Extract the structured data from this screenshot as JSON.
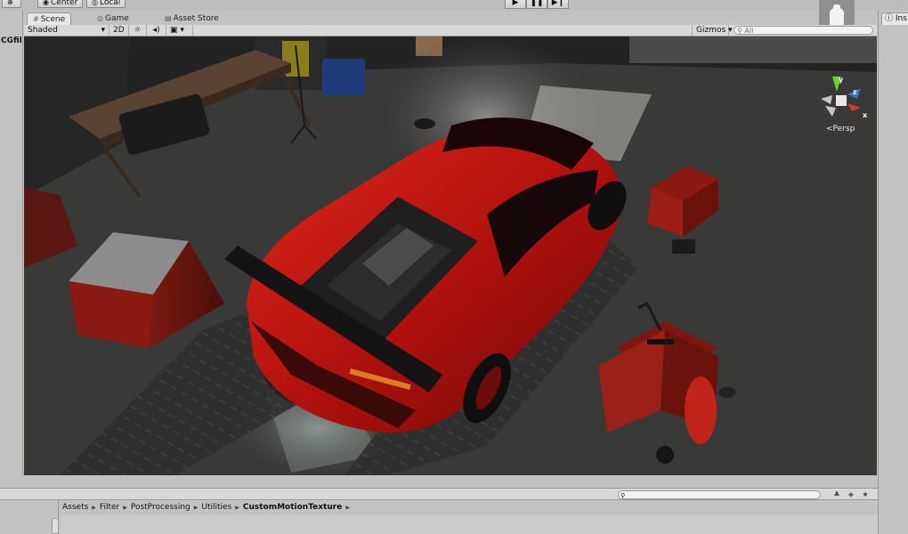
{
  "toolbar": {
    "center_label": "Center",
    "local_label": "Local",
    "play_icon": "play-icon",
    "pause_icon": "pause-icon",
    "step_icon": "step-icon"
  },
  "left_panel": {
    "label": "CGfil"
  },
  "tabs": {
    "scene": "Scene",
    "game": "Game",
    "asset_store": "Asset Store"
  },
  "scene_bar": {
    "shading_mode": "Shaded",
    "mode_2d": "2D",
    "gizmos_label": "Gizmos",
    "search_placeholder": "All"
  },
  "viewport": {
    "projection_label": "<Persp",
    "axis_x": "x",
    "axis_y": "y",
    "axis_z": "z"
  },
  "inspector": {
    "tab_label": "Ins"
  },
  "project": {
    "breadcrumb": [
      "Assets",
      "Filter",
      "PostProcessing",
      "Utilities",
      "CustomMotionTexture"
    ]
  },
  "colors": {
    "car_red": "#b3120e",
    "floor": "#3a3a3a",
    "editor_gray": "#c2c2c2"
  }
}
